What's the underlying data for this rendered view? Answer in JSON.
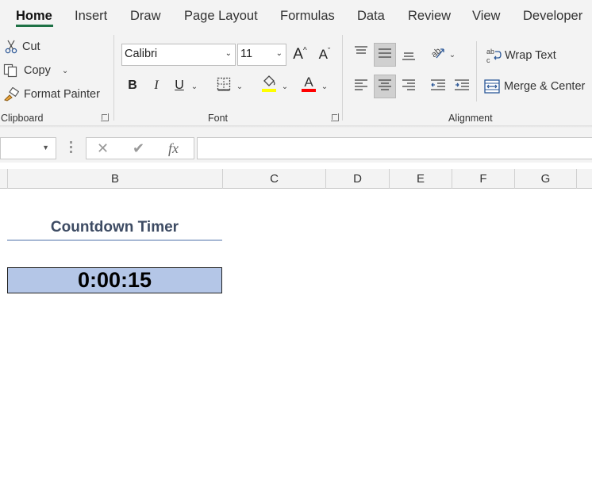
{
  "ribbon_tabs": [
    "Home",
    "Insert",
    "Draw",
    "Page Layout",
    "Formulas",
    "Data",
    "Review",
    "View",
    "Developer"
  ],
  "clipboard": {
    "cut_label": "Cut",
    "copy_label": "Copy",
    "format_painter_label": "Format Painter",
    "group_label": "Clipboard"
  },
  "font": {
    "font_name": "Calibri",
    "font_size": "11",
    "group_label": "Font",
    "highlight_color": "#ffff00",
    "font_color": "#ff0000"
  },
  "alignment": {
    "wrap_text_label": "Wrap Text",
    "merge_center_label": "Merge & Center",
    "group_label": "Alignment"
  },
  "formula_bar": {
    "name_box": "",
    "formula": ""
  },
  "columns": [
    "B",
    "C",
    "D",
    "E",
    "F",
    "G"
  ],
  "sheet": {
    "title": "Countdown Timer",
    "timer_value": "0:00:15",
    "timer_fill": "#b4c6e7"
  },
  "colors": {
    "accent": "#1e7145",
    "title_text": "#3d4b63"
  }
}
